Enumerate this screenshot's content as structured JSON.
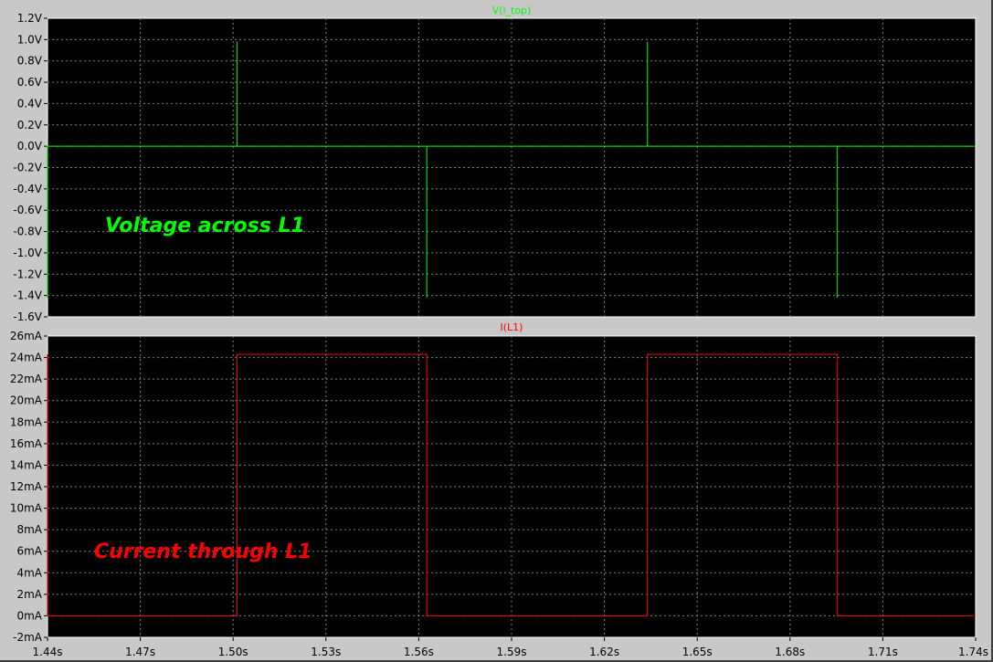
{
  "colors": {
    "plot_bg": "#000000",
    "grid": "#808080",
    "voltage_trace": "#00ff00",
    "current_trace": "#ff0000",
    "outer_bg": "#c8c8c8"
  },
  "chart_data": [
    {
      "type": "line",
      "title": "V(l_top)",
      "title_color": "#00ff00",
      "annotation": "Voltage across L1",
      "annotation_color": "#00ff00",
      "ylim": [
        -1.6,
        1.2
      ],
      "yticks": [
        -1.6,
        -1.4,
        -1.2,
        -1.0,
        -0.8,
        -0.6,
        -0.4,
        -0.2,
        0.0,
        0.2,
        0.4,
        0.6,
        0.8,
        1.0,
        1.2
      ],
      "ytick_labels": [
        "-1.6V",
        "-1.4V",
        "-1.2V",
        "-1.0V",
        "-0.8V",
        "-0.6V",
        "-0.4V",
        "-0.2V",
        "0.0V",
        "0.2V",
        "0.4V",
        "0.6V",
        "0.8V",
        "1.0V",
        "1.2V"
      ],
      "grid": true,
      "series": [
        {
          "x": [
            1.44,
            1.44,
            1.44,
            1.5013,
            1.5013,
            1.5013,
            1.5626,
            1.5626,
            1.5626,
            1.6339,
            1.6339,
            1.6339,
            1.6952,
            1.6952,
            1.6952,
            1.74
          ],
          "y": [
            -1.42,
            0,
            0,
            0,
            0.98,
            0,
            0,
            -1.42,
            0,
            0,
            0.98,
            0,
            0,
            -1.42,
            0,
            0
          ]
        }
      ]
    },
    {
      "type": "line",
      "title": "I(L1)",
      "title_color": "#ff0000",
      "annotation": "Current through L1",
      "annotation_color": "#ff0000",
      "ylim": [
        -2,
        26
      ],
      "yticks": [
        -2,
        0,
        2,
        4,
        6,
        8,
        10,
        12,
        14,
        16,
        18,
        20,
        22,
        24,
        26
      ],
      "ytick_labels": [
        "-2mA",
        "0mA",
        "2mA",
        "4mA",
        "6mA",
        "8mA",
        "10mA",
        "12mA",
        "14mA",
        "16mA",
        "18mA",
        "20mA",
        "22mA",
        "24mA",
        "26mA"
      ],
      "grid": true,
      "series": [
        {
          "x": [
            1.44,
            1.44,
            1.44,
            1.5013,
            1.5013,
            1.5626,
            1.5626,
            1.6339,
            1.6339,
            1.6952,
            1.6952,
            1.74
          ],
          "y": [
            24.3,
            0,
            0,
            0,
            24.3,
            24.3,
            0,
            0,
            24.3,
            24.3,
            0,
            0
          ]
        }
      ]
    }
  ],
  "x_axis": {
    "xlim": [
      1.44,
      1.74
    ],
    "ticks": [
      1.44,
      1.47,
      1.5,
      1.53,
      1.56,
      1.59,
      1.62,
      1.65,
      1.68,
      1.71,
      1.74
    ],
    "tick_labels": [
      "1.44s",
      "1.47s",
      "1.50s",
      "1.53s",
      "1.56s",
      "1.59s",
      "1.62s",
      "1.65s",
      "1.68s",
      "1.71s",
      "1.74s"
    ]
  }
}
